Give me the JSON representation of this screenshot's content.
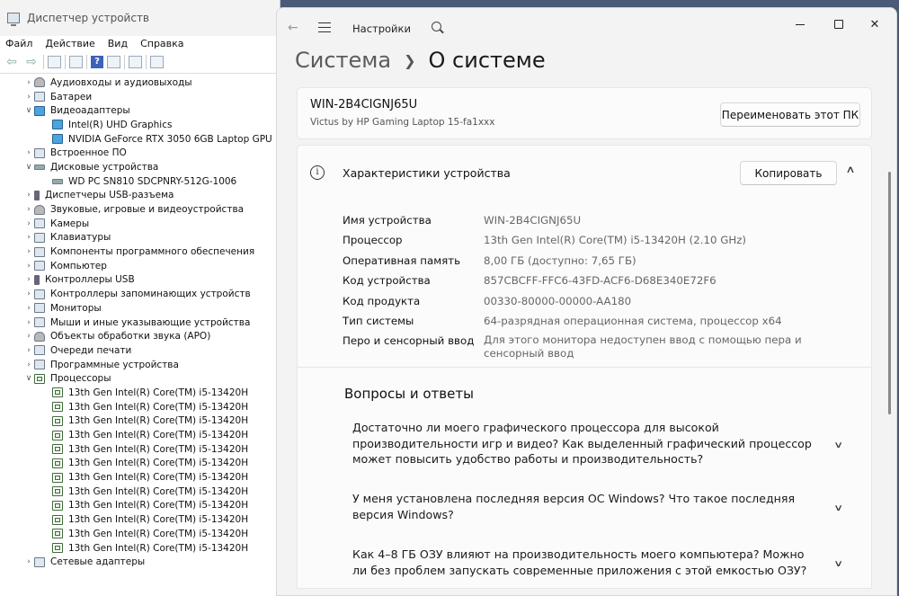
{
  "device_manager": {
    "title": "Диспетчер устройств",
    "menu": [
      "Файл",
      "Действие",
      "Вид",
      "Справка"
    ],
    "tree": [
      {
        "label": "Аудиовходы и аудиовыходы",
        "level": 0,
        "expanded": false,
        "icon": "sound-icon"
      },
      {
        "label": "Батареи",
        "level": 0,
        "expanded": false,
        "icon": "battery-icon"
      },
      {
        "label": "Видеоадаптеры",
        "level": 0,
        "expanded": true,
        "icon": "display-adapter-icon"
      },
      {
        "label": "Intel(R) UHD Graphics",
        "level": 1,
        "icon": "display-adapter-icon"
      },
      {
        "label": "NVIDIA GeForce RTX 3050 6GB Laptop GPU",
        "level": 1,
        "icon": "display-adapter-icon"
      },
      {
        "label": "Встроенное ПО",
        "level": 0,
        "expanded": false,
        "icon": "firmware-icon"
      },
      {
        "label": "Дисковые устройства",
        "level": 0,
        "expanded": true,
        "icon": "disk-icon"
      },
      {
        "label": "WD PC SN810 SDCPNRY-512G-1006",
        "level": 1,
        "icon": "disk-icon"
      },
      {
        "label": "Диспетчеры USB-разъема",
        "level": 0,
        "expanded": false,
        "icon": "usb-icon"
      },
      {
        "label": "Звуковые, игровые и видеоустройства",
        "level": 0,
        "expanded": false,
        "icon": "sound-icon"
      },
      {
        "label": "Камеры",
        "level": 0,
        "expanded": false,
        "icon": "camera-icon"
      },
      {
        "label": "Клавиатуры",
        "level": 0,
        "expanded": false,
        "icon": "keyboard-icon"
      },
      {
        "label": "Компоненты программного обеспечения",
        "level": 0,
        "expanded": false,
        "icon": "software-icon"
      },
      {
        "label": "Компьютер",
        "level": 0,
        "expanded": false,
        "icon": "computer-icon"
      },
      {
        "label": "Контроллеры USB",
        "level": 0,
        "expanded": false,
        "icon": "usb-icon"
      },
      {
        "label": "Контроллеры запоминающих устройств",
        "level": 0,
        "expanded": false,
        "icon": "storage-controller-icon"
      },
      {
        "label": "Мониторы",
        "level": 0,
        "expanded": false,
        "icon": "monitor-icon"
      },
      {
        "label": "Мыши и иные указывающие устройства",
        "level": 0,
        "expanded": false,
        "icon": "mouse-icon"
      },
      {
        "label": "Объекты обработки звука (APO)",
        "level": 0,
        "expanded": false,
        "icon": "sound-icon"
      },
      {
        "label": "Очереди печати",
        "level": 0,
        "expanded": false,
        "icon": "printer-icon"
      },
      {
        "label": "Программные устройства",
        "level": 0,
        "expanded": false,
        "icon": "software-device-icon"
      },
      {
        "label": "Процессоры",
        "level": 0,
        "expanded": true,
        "icon": "cpu-icon"
      },
      {
        "label": "13th Gen Intel(R) Core(TM) i5-13420H",
        "level": 1,
        "icon": "cpu-icon"
      },
      {
        "label": "13th Gen Intel(R) Core(TM) i5-13420H",
        "level": 1,
        "icon": "cpu-icon"
      },
      {
        "label": "13th Gen Intel(R) Core(TM) i5-13420H",
        "level": 1,
        "icon": "cpu-icon"
      },
      {
        "label": "13th Gen Intel(R) Core(TM) i5-13420H",
        "level": 1,
        "icon": "cpu-icon"
      },
      {
        "label": "13th Gen Intel(R) Core(TM) i5-13420H",
        "level": 1,
        "icon": "cpu-icon"
      },
      {
        "label": "13th Gen Intel(R) Core(TM) i5-13420H",
        "level": 1,
        "icon": "cpu-icon"
      },
      {
        "label": "13th Gen Intel(R) Core(TM) i5-13420H",
        "level": 1,
        "icon": "cpu-icon"
      },
      {
        "label": "13th Gen Intel(R) Core(TM) i5-13420H",
        "level": 1,
        "icon": "cpu-icon"
      },
      {
        "label": "13th Gen Intel(R) Core(TM) i5-13420H",
        "level": 1,
        "icon": "cpu-icon"
      },
      {
        "label": "13th Gen Intel(R) Core(TM) i5-13420H",
        "level": 1,
        "icon": "cpu-icon"
      },
      {
        "label": "13th Gen Intel(R) Core(TM) i5-13420H",
        "level": 1,
        "icon": "cpu-icon"
      },
      {
        "label": "13th Gen Intel(R) Core(TM) i5-13420H",
        "level": 1,
        "icon": "cpu-icon"
      },
      {
        "label": "Сетевые адаптеры",
        "level": 0,
        "expanded": false,
        "icon": "network-icon"
      }
    ]
  },
  "settings": {
    "app_name": "Настройки",
    "breadcrumb": {
      "parent": "Система",
      "current": "О системе"
    },
    "pc": {
      "name": "WIN-2B4CIGNJ65U",
      "model": "Victus by HP Gaming Laptop 15-fa1xxx",
      "rename_label": "Переименовать этот ПК"
    },
    "specs": {
      "title": "Характеристики устройства",
      "copy_label": "Копировать",
      "rows": [
        {
          "key": "Имя устройства",
          "value": "WIN-2B4CIGNJ65U"
        },
        {
          "key": "Процессор",
          "value": "13th Gen Intel(R) Core(TM) i5-13420H (2.10 GHz)"
        },
        {
          "key": "Оперативная память",
          "value": "8,00 ГБ (доступно: 7,65 ГБ)"
        },
        {
          "key": "Код устройства",
          "value": "857CBCFF-FFC6-43FD-ACF6-D68E340E72F6"
        },
        {
          "key": "Код продукта",
          "value": "00330-80000-00000-AA180"
        },
        {
          "key": "Тип системы",
          "value": "64-разрядная операционная система, процессор x64"
        },
        {
          "key": "Перо и сенсорный ввод",
          "value": "Для этого монитора недоступен ввод с помощью пера и сенсорный ввод"
        }
      ]
    },
    "faq": {
      "title": "Вопросы и ответы",
      "items": [
        "Достаточно ли моего графического процессора для высокой производительности игр и видео? Как выделенный графический процессор может повысить удобство работы и производительность?",
        "У меня установлена последняя версия ОС Windows? Что такое последняя версия Windows?",
        "Как 4–8 ГБ ОЗУ влияют на производительность моего компьютера? Можно ли без проблем запускать современные приложения с этой емкостью ОЗУ?"
      ]
    }
  }
}
